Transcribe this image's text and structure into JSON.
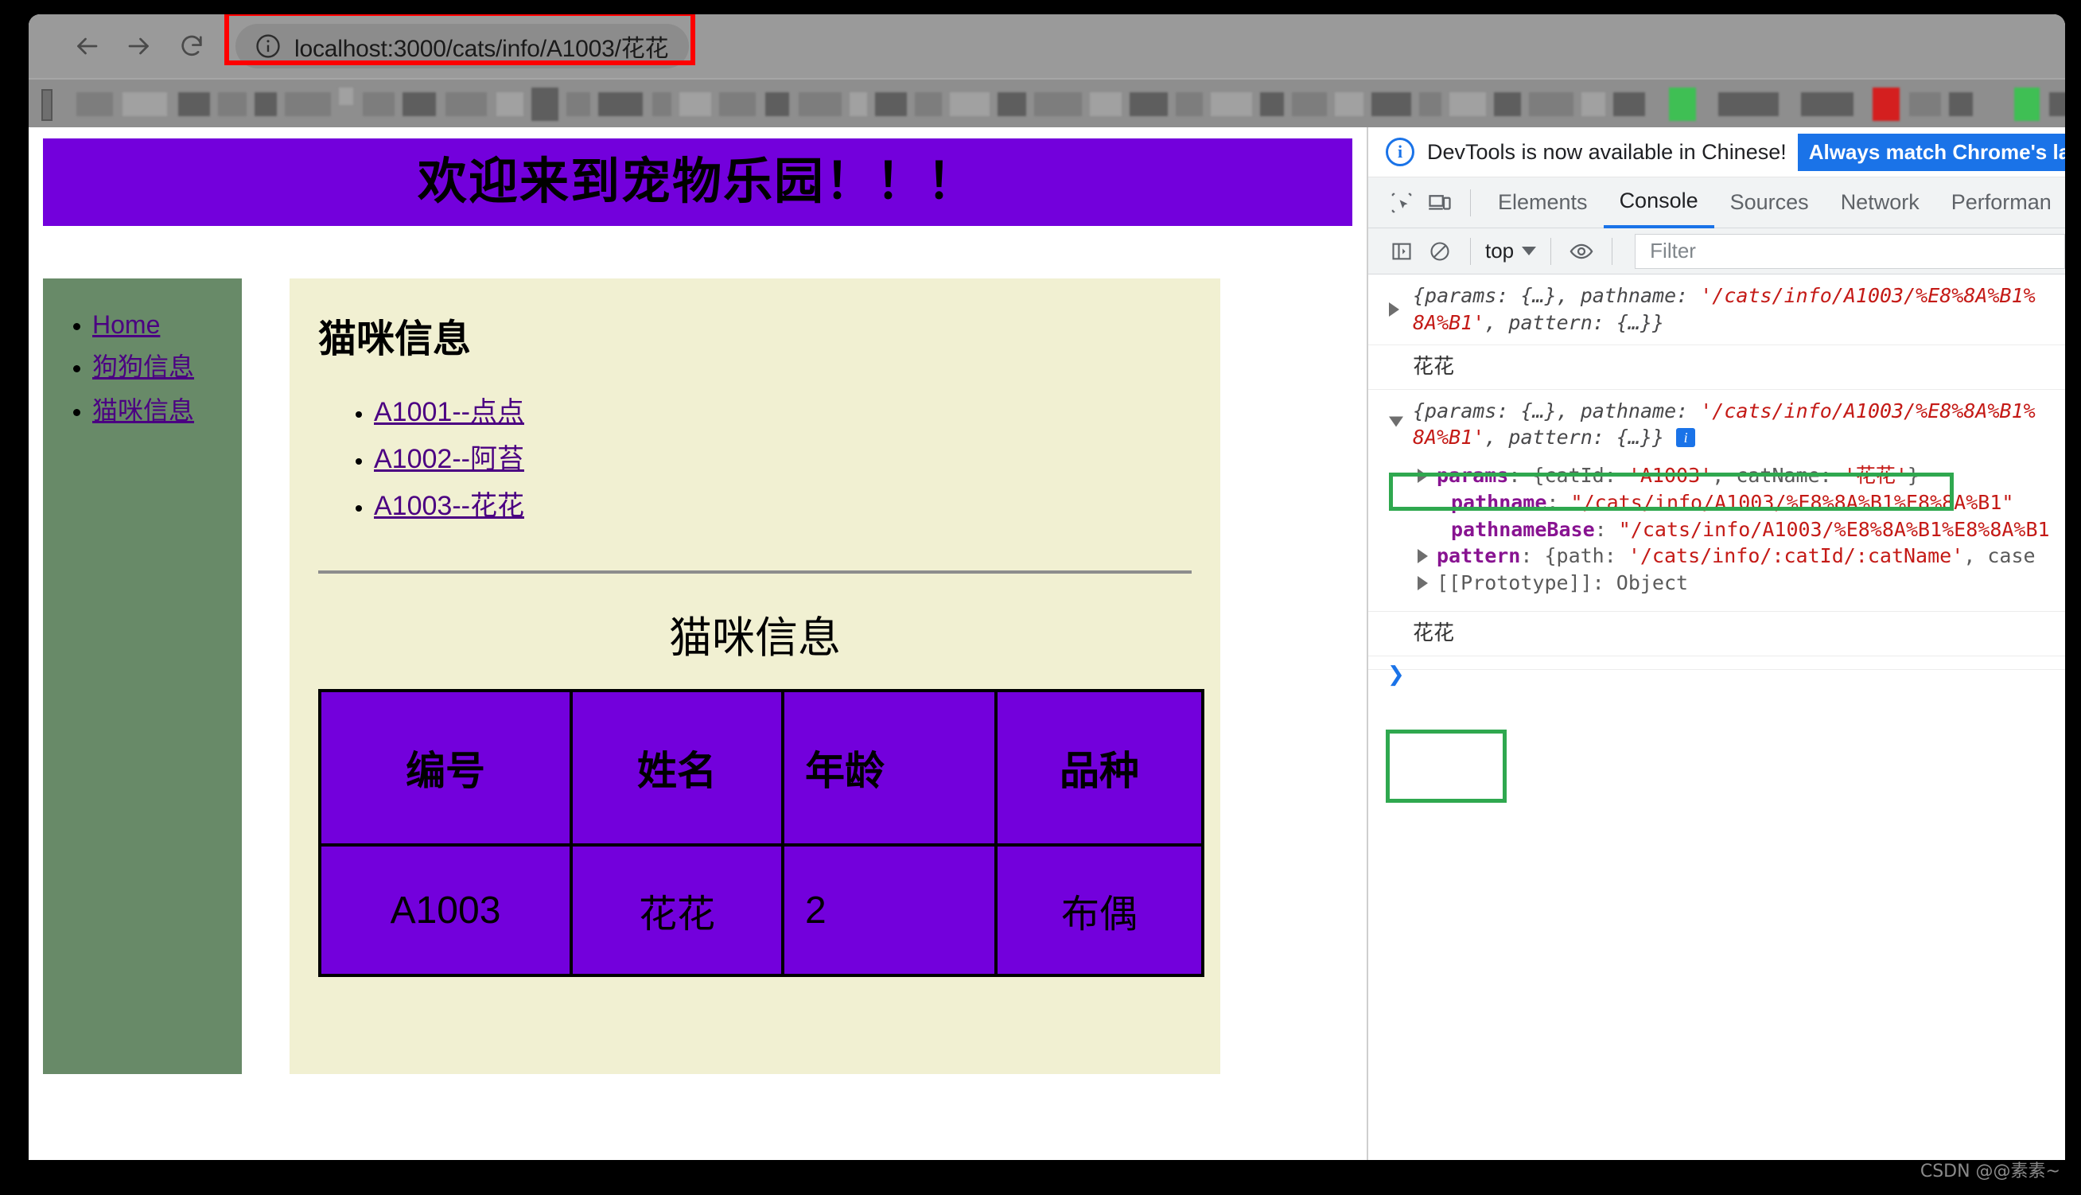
{
  "browser": {
    "back_label": "Back",
    "forward_label": "Forward",
    "reload_label": "Reload",
    "url": "localhost:3000/cats/info/A1003/花花",
    "site_info_icon": "info-circle-icon",
    "highlight_color": "#ff0000"
  },
  "page": {
    "banner_title": "欢迎来到宠物乐园！！！",
    "banner_color": "#7300dc",
    "sidebar_color": "#688a68",
    "content_color": "#f1f0d2",
    "sidebar": {
      "items": [
        {
          "label": "Home"
        },
        {
          "label": "狗狗信息"
        },
        {
          "label": "猫咪信息"
        }
      ]
    },
    "section_title": "猫咪信息",
    "cat_links": [
      {
        "label": "A1001--点点"
      },
      {
        "label": "A1002--阿苔"
      },
      {
        "label": "A1003--花花"
      }
    ],
    "table": {
      "title": "猫咪信息",
      "headers": [
        "编号",
        "姓名",
        "年龄",
        "品种"
      ],
      "rows": [
        [
          "A1003",
          "花花",
          "2",
          "布偶"
        ]
      ]
    }
  },
  "devtools": {
    "notice": {
      "text": "DevTools is now available in Chinese!",
      "button_label": "Always match Chrome's langua"
    },
    "icons": {
      "inspect": "inspect-element-icon",
      "device": "device-toolbar-icon",
      "sidebar": "console-sidebar-icon",
      "clear": "clear-console-icon",
      "eye": "live-expression-icon"
    },
    "tabs": [
      {
        "label": "Elements",
        "active": false
      },
      {
        "label": "Console",
        "active": true
      },
      {
        "label": "Sources",
        "active": false
      },
      {
        "label": "Network",
        "active": false
      },
      {
        "label": "Performan",
        "active": false
      }
    ],
    "console_bar": {
      "context": "top",
      "filter_placeholder": "Filter"
    },
    "console": {
      "entry1": {
        "line1_a": "{params: {…}, pathname: ",
        "line1_str": "'/cats/info/A1003/%E8%8A%B1%",
        "line2_str": "8A%B1'",
        "line2_b": ", pattern: {…}}"
      },
      "entry2_output": "花花",
      "entry3": {
        "line1_a": "{params: {…}, pathname: ",
        "line1_str": "'/cats/info/A1003/%E8%8A%B1%",
        "line2_str": "8A%B1'",
        "line2_b": ", pattern: {…}}",
        "params_key": "params",
        "params_val_a": ": {catId: ",
        "params_catid": "'A1003'",
        "params_mid": ", catName: ",
        "params_catname": "'花花'",
        "params_end": "}",
        "pathname_key": "pathname",
        "pathname_val": "\"/cats/info/A1003/%E8%8A%B1%E8%8A%B1\"",
        "pathnamebase_key": "pathnameBase",
        "pathnamebase_val": "\"/cats/info/A1003/%E8%8A%B1%E8%8A%B1",
        "pattern_key": "pattern",
        "pattern_val_a": ": {path: ",
        "pattern_path": "'/cats/info/:catId/:catName'",
        "pattern_end": ", case",
        "prototype_label": "[[Prototype]]: Object"
      },
      "entry4_output": "花花",
      "prompt_symbol": "❯",
      "highlight_color": "#2fa84f"
    }
  },
  "watermark": "CSDN @@素素~"
}
